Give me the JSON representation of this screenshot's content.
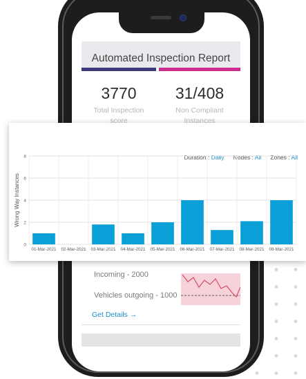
{
  "report": {
    "title": "Automated Inspection Report",
    "stat1": {
      "value": "3770",
      "label1": "Total Inspection",
      "label2": "score"
    },
    "stat2": {
      "value": "31/408",
      "label1": "Non Compliant",
      "label2": "Instances"
    }
  },
  "lower": {
    "incoming": "Incoming - 2000",
    "outgoing": "Vehicles outgoing - 1000",
    "details": "Get Details →"
  },
  "filters": {
    "duration_label": "Duration :",
    "duration_value": "Daily",
    "nodes_label": "Nodes :",
    "nodes_value": "All",
    "zones_label": "Zones :",
    "zones_value": "All"
  },
  "colors": {
    "bar": "#0a9fd6",
    "accent": "#1d8ccb",
    "purple": "#3e3a7e",
    "magenta": "#cc2c8e"
  },
  "chart_data": {
    "type": "bar",
    "ylabel": "Wrong Way Instances",
    "xlabel": "",
    "categories": [
      "01-Mar-2021",
      "02-Mar-2021",
      "03-Mar-2021",
      "04-Mar-2021",
      "05-Mar-2021",
      "06-Mar-2021",
      "07-Mar-2021",
      "08-Mar-2021",
      "09-Mar-2021"
    ],
    "tick_labels": [
      "01-Mar-2021",
      "02-Mar-2021",
      "03-Mar-2021",
      "04-Mar-2021",
      "05-Mar-2021",
      "06-Mar-2021",
      "07-Mar-2021",
      "08-Mar-2021",
      "09-Mar-2021"
    ],
    "values": [
      1,
      0,
      1.8,
      1,
      2,
      4,
      1.3,
      2.1,
      4
    ],
    "ylim": [
      0,
      8
    ],
    "yticks": [
      "0",
      "2",
      "4",
      "6",
      "8"
    ],
    "grid": true
  }
}
